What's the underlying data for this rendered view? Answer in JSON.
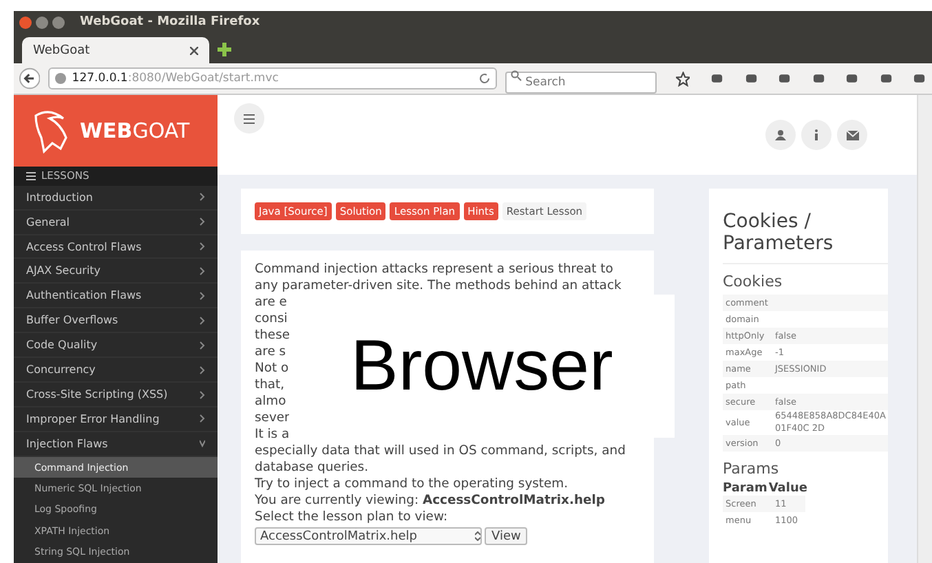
{
  "window": {
    "title": "WebGoat - Mozilla Firefox"
  },
  "tabs": [
    {
      "label": "WebGoat",
      "selected": true
    }
  ],
  "address": {
    "host": "127.0.0.1",
    "path": ":8080/WebGoat/start.mvc"
  },
  "search": {
    "placeholder": "Search"
  },
  "sidebar": {
    "brand_bold": "WEB",
    "brand_light": "GOAT",
    "header": "LESSONS",
    "items": [
      {
        "label": "Introduction",
        "expanded": false
      },
      {
        "label": "General",
        "expanded": false
      },
      {
        "label": "Access Control Flaws",
        "expanded": false
      },
      {
        "label": "AJAX Security",
        "expanded": false
      },
      {
        "label": "Authentication Flaws",
        "expanded": false
      },
      {
        "label": "Buffer Overflows",
        "expanded": false
      },
      {
        "label": "Code Quality",
        "expanded": false
      },
      {
        "label": "Concurrency",
        "expanded": false
      },
      {
        "label": "Cross-Site Scripting (XSS)",
        "expanded": false
      },
      {
        "label": "Improper Error Handling",
        "expanded": false
      },
      {
        "label": "Injection Flaws",
        "expanded": true,
        "children": [
          {
            "label": "Command Injection",
            "selected": true
          },
          {
            "label": "Numeric SQL Injection",
            "selected": false
          },
          {
            "label": "Log Spoofing",
            "selected": false
          },
          {
            "label": "XPATH Injection",
            "selected": false
          },
          {
            "label": "String SQL Injection",
            "selected": false
          }
        ]
      }
    ]
  },
  "lesson_buttons": [
    {
      "label": "Java [Source]",
      "kind": "primary"
    },
    {
      "label": "Solution",
      "kind": "primary"
    },
    {
      "label": "Lesson Plan",
      "kind": "primary"
    },
    {
      "label": "Hints",
      "kind": "primary"
    },
    {
      "label": "Restart Lesson",
      "kind": "plain"
    }
  ],
  "content": {
    "lines": [
      "Command  injection attacks represent a serious threat to",
      "any parameter-driven site. The methods behind an attack",
      "are e",
      "consi",
      "these",
      "are s",
      "Not o",
      "that,",
      "almo",
      "sever",
      "It is a",
      "especially data that will used in OS command, scripts, and",
      "database queries.",
      "Try to inject a command to the operating system.",
      "You are currently viewing: **AccessControlMatrix.help**",
      "Select the lesson plan to view:"
    ],
    "select_value": "AccessControlMatrix.help",
    "view_button": "View"
  },
  "overlay_label": "Browser",
  "panel": {
    "title": "Cookies / Parameters",
    "cookies_heading": "Cookies",
    "cookies": [
      {
        "key": "comment"
      },
      {
        "key": "domain"
      },
      {
        "key": "httpOnly",
        "value": "false"
      },
      {
        "key": "maxAge",
        "value": "-1"
      },
      {
        "key": "name",
        "value": "JSESSIONID"
      },
      {
        "key": "path"
      },
      {
        "key": "secure",
        "value": "false"
      },
      {
        "key": "value",
        "value": "65448E858A8DC84E40A01F40C 2D"
      },
      {
        "key": "version",
        "value": "0"
      }
    ],
    "params_heading": "Params",
    "params_columns": [
      "Param",
      "Value"
    ],
    "params": [
      {
        "key": "Screen",
        "value": "11"
      },
      {
        "key": "menu",
        "value": "1100"
      }
    ]
  }
}
